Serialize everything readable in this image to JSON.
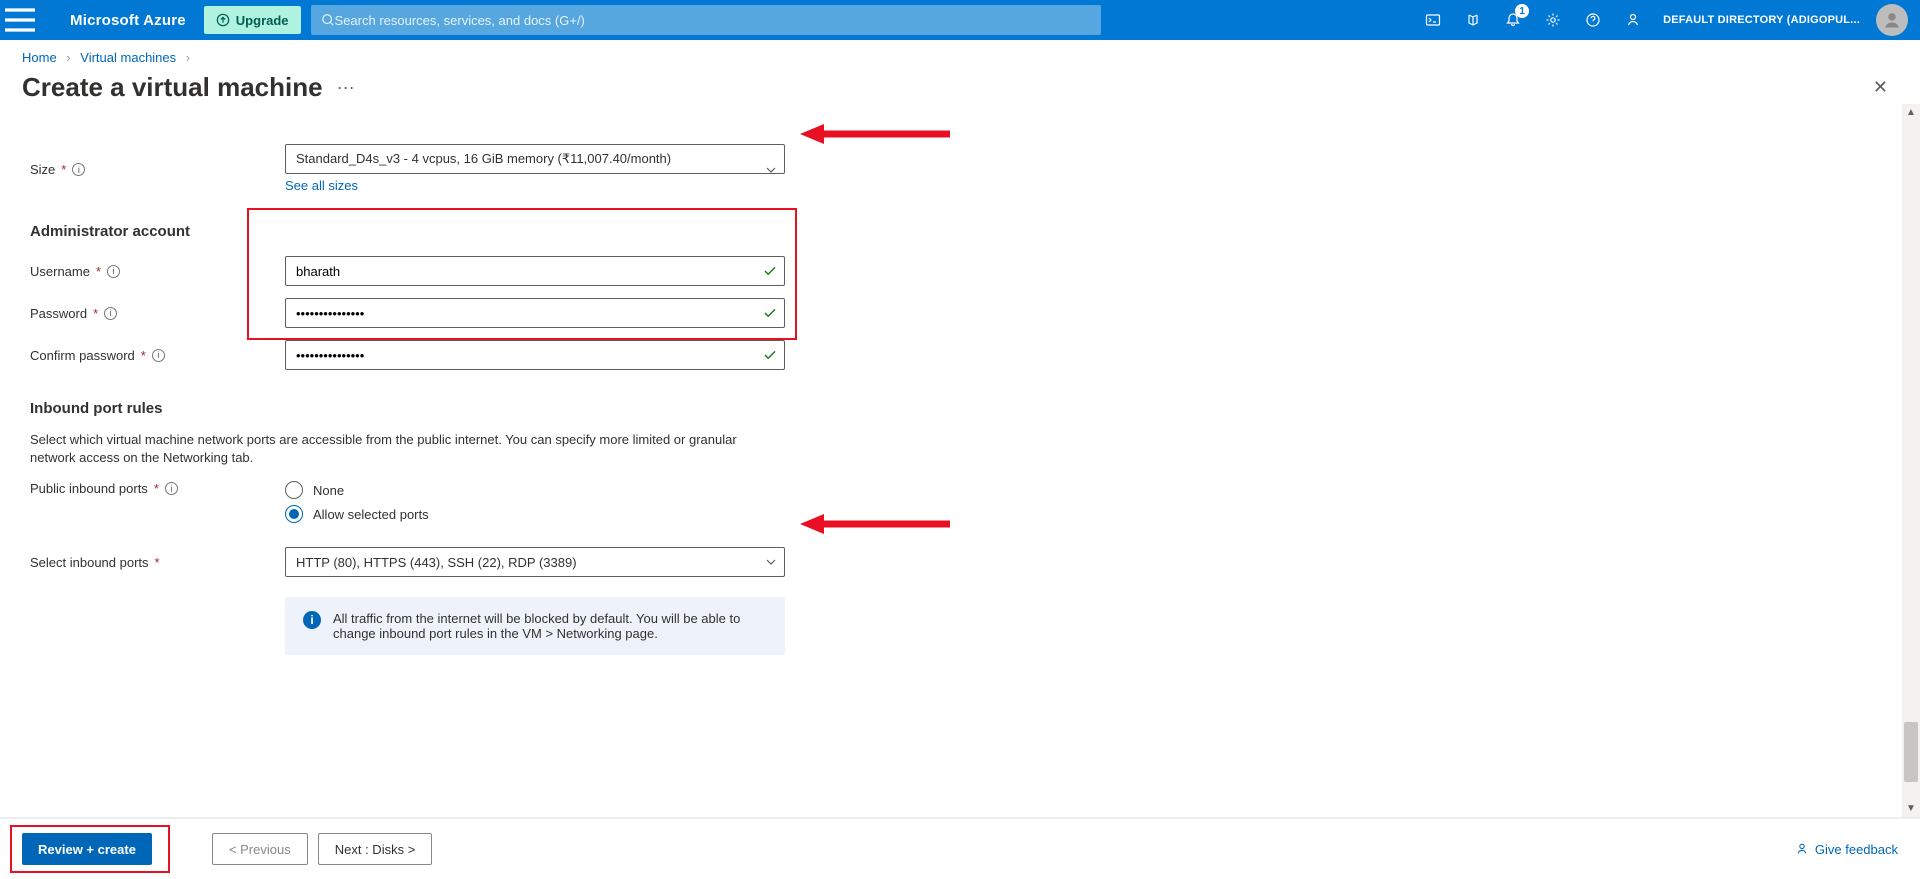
{
  "header": {
    "brand": "Microsoft Azure",
    "upgrade_label": "Upgrade",
    "search_placeholder": "Search resources, services, and docs (G+/)",
    "notification_count": "1",
    "tenant": "DEFAULT DIRECTORY (ADIGOPUL..."
  },
  "breadcrumb": {
    "items": [
      "Home",
      "Virtual machines"
    ]
  },
  "page": {
    "title": "Create a virtual machine",
    "more": "···"
  },
  "form": {
    "size": {
      "label": "Size",
      "value": "Standard_D4s_v3 - 4 vcpus, 16 GiB memory (₹11,007.40/month)",
      "link": "See all sizes"
    },
    "admin_section": "Administrator account",
    "username": {
      "label": "Username",
      "value": "bharath"
    },
    "password": {
      "label": "Password",
      "value": "•••••••••••••••"
    },
    "confirm": {
      "label": "Confirm password",
      "value": "•••••••••••••••"
    },
    "ports_section": "Inbound port rules",
    "ports_desc": "Select which virtual machine network ports are accessible from the public internet. You can specify more limited or granular network access on the Networking tab.",
    "pip": {
      "label": "Public inbound ports",
      "none": "None",
      "allow": "Allow selected ports"
    },
    "sip": {
      "label": "Select inbound ports",
      "value": "HTTP (80), HTTPS (443), SSH (22), RDP (3389)"
    },
    "info_box": "All traffic from the internet will be blocked by default. You will be able to change inbound port rules in the VM > Networking page."
  },
  "footer": {
    "review": "Review + create",
    "prev": "< Previous",
    "next": "Next : Disks >",
    "feedback": "Give feedback"
  }
}
